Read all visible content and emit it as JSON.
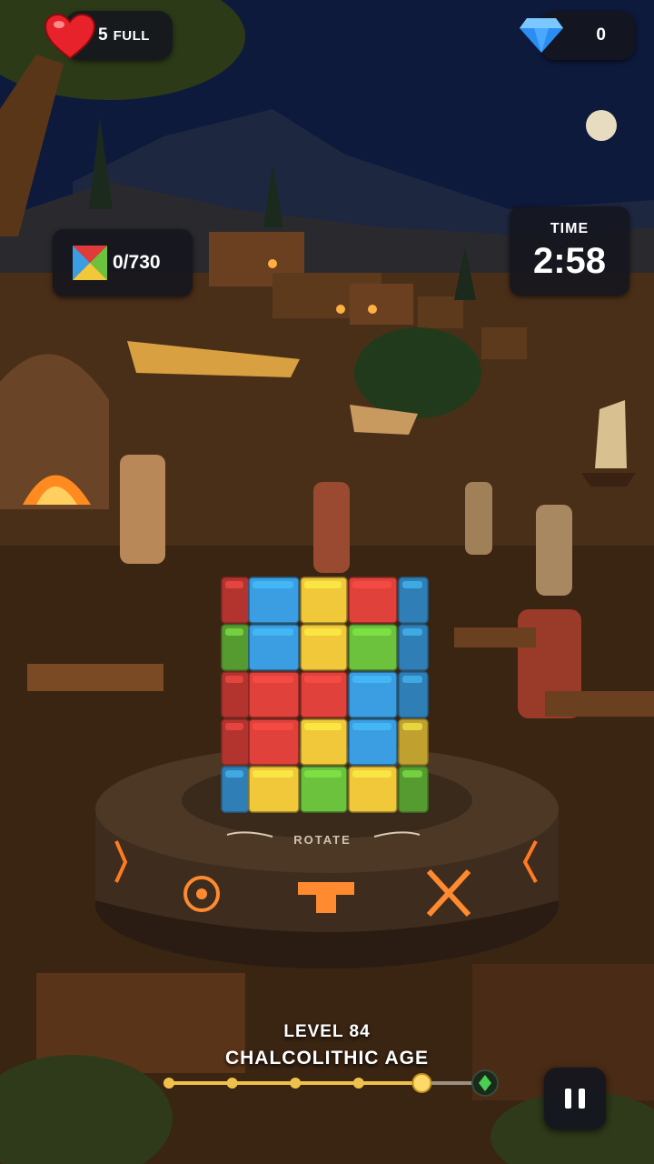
{
  "hud": {
    "lives_count": "5",
    "lives_status": "FULL",
    "gems_count": "0",
    "progress": "0/730",
    "time_label": "TIME",
    "time_value": "2:58"
  },
  "board": {
    "rotate_label": "ROTATE",
    "columns": [
      [
        "red",
        "green",
        "red",
        "red",
        "blue"
      ],
      [
        "blue",
        "blue",
        "red",
        "red",
        "yellow"
      ],
      [
        "yellow",
        "yellow",
        "red",
        "yellow",
        "green"
      ],
      [
        "red",
        "green",
        "blue",
        "blue",
        "yellow"
      ],
      [
        "blue",
        "blue",
        "blue",
        "yellow",
        "green"
      ]
    ]
  },
  "level": {
    "number_label": "LEVEL 84",
    "age_label": "CHALCOLITHIC AGE",
    "milestones_completed": 4,
    "milestones_total": 6
  },
  "colors": {
    "red": "#e0413a",
    "blue": "#3b9ee3",
    "yellow": "#f0c83a",
    "green": "#6cc23c",
    "track_gold": "#f0c14a",
    "hud_bg": "#14161e"
  },
  "icons": {
    "lives": "heart-icon",
    "gems": "diamond-icon",
    "progress": "color-cube-icon",
    "pause": "pause-icon",
    "goal": "leaf-gem-icon"
  }
}
